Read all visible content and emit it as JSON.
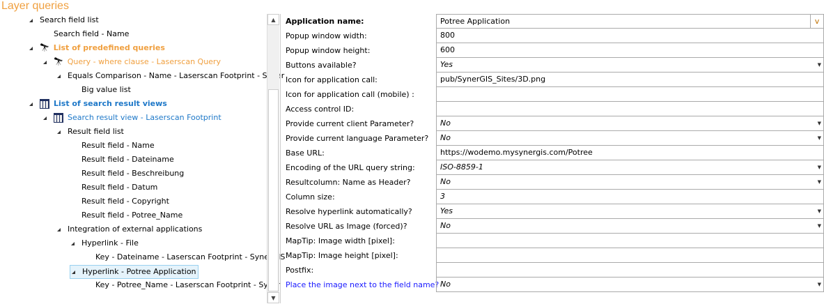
{
  "title": "Layer queries",
  "tree": [
    {
      "label": "Search field list",
      "level": 0,
      "expander": true,
      "style": ""
    },
    {
      "label": "Search field - Name",
      "level": 1,
      "expander": false,
      "style": ""
    },
    {
      "label": "List of predefined queries",
      "level": 0,
      "expander": true,
      "style": "orange bold",
      "icon": "binoculars"
    },
    {
      "label": "Query - where clause - Laserscan Query",
      "level": 1,
      "expander": true,
      "style": "orange",
      "icon": "binoculars"
    },
    {
      "label": "Equals Comparison - Name - Laserscan Footprint - Syner",
      "level": 2,
      "expander": true,
      "style": ""
    },
    {
      "label": "Big value list",
      "level": 3,
      "expander": false,
      "style": ""
    },
    {
      "label": "List of search result views",
      "level": 0,
      "expander": true,
      "style": "blue bold",
      "icon": "table"
    },
    {
      "label": "Search result view - Laserscan Footprint",
      "level": 1,
      "expander": true,
      "style": "blue",
      "icon": "table"
    },
    {
      "label": "Result field list",
      "level": 2,
      "expander": true,
      "style": ""
    },
    {
      "label": "Result field - Name",
      "level": 3,
      "expander": false,
      "style": ""
    },
    {
      "label": "Result field - Dateiname",
      "level": 3,
      "expander": false,
      "style": ""
    },
    {
      "label": "Result field - Beschreibung",
      "level": 3,
      "expander": false,
      "style": ""
    },
    {
      "label": "Result field - Datum",
      "level": 3,
      "expander": false,
      "style": ""
    },
    {
      "label": "Result field - Copyright",
      "level": 3,
      "expander": false,
      "style": ""
    },
    {
      "label": "Result field - Potree_Name",
      "level": 3,
      "expander": false,
      "style": ""
    },
    {
      "label": "Integration of external applications",
      "level": 2,
      "expander": true,
      "style": ""
    },
    {
      "label": "Hyperlink - File",
      "level": 3,
      "expander": true,
      "style": ""
    },
    {
      "label": "Key - Dateiname - Laserscan Footprint - SynerGIS",
      "level": 4,
      "expander": false,
      "style": ""
    },
    {
      "label": "Hyperlink - Potree Application",
      "level": 3,
      "expander": true,
      "style": "sel"
    },
    {
      "label": "Key - Potree_Name - Laserscan Footprint - Syner",
      "level": 4,
      "expander": false,
      "style": ""
    }
  ],
  "properties": [
    {
      "label": "Application name:",
      "value": "Potree Application",
      "bold": true,
      "type": "vbutton",
      "vlabel": "v"
    },
    {
      "label": "Popup window width:",
      "value": "800",
      "type": "text"
    },
    {
      "label": "Popup window height:",
      "value": "600",
      "type": "text"
    },
    {
      "label": "Buttons available?",
      "value": "Yes",
      "type": "dropdown"
    },
    {
      "label": "Icon for application call:",
      "value": "pub/SynerGIS_Sites/3D.png",
      "type": "text"
    },
    {
      "label": "Icon for application call (mobile) :",
      "value": "",
      "type": "text"
    },
    {
      "label": "Access control ID:",
      "value": "",
      "type": "text"
    },
    {
      "label": "Provide current client Parameter?",
      "value": "No",
      "type": "dropdown"
    },
    {
      "label": "Provide current language Parameter?",
      "value": "No",
      "type": "dropdown"
    },
    {
      "label": "Base URL:",
      "value": "https://wodemo.mysynergis.com/Potree",
      "type": "text"
    },
    {
      "label": "Encoding of the URL query string:",
      "value": "ISO-8859-1",
      "type": "dropdown"
    },
    {
      "label": "Resultcolumn: Name as Header?",
      "value": "No",
      "type": "dropdown"
    },
    {
      "label": "Column size:",
      "value": "3",
      "type": "italic"
    },
    {
      "label": "Resolve hyperlink automatically?",
      "value": "Yes",
      "type": "dropdown"
    },
    {
      "label": "Resolve URL as Image (forced)?",
      "value": "No",
      "type": "dropdown"
    },
    {
      "label": "MapTip: Image width [pixel]:",
      "value": "",
      "type": "text"
    },
    {
      "label": "MapTip: Image height [pixel]:",
      "value": "",
      "type": "text"
    },
    {
      "label": "Postfix:",
      "value": "",
      "type": "text"
    },
    {
      "label": "Place the image next to the field name?",
      "value": "No",
      "type": "dropdown",
      "labelColor": "#1a1aff"
    }
  ]
}
